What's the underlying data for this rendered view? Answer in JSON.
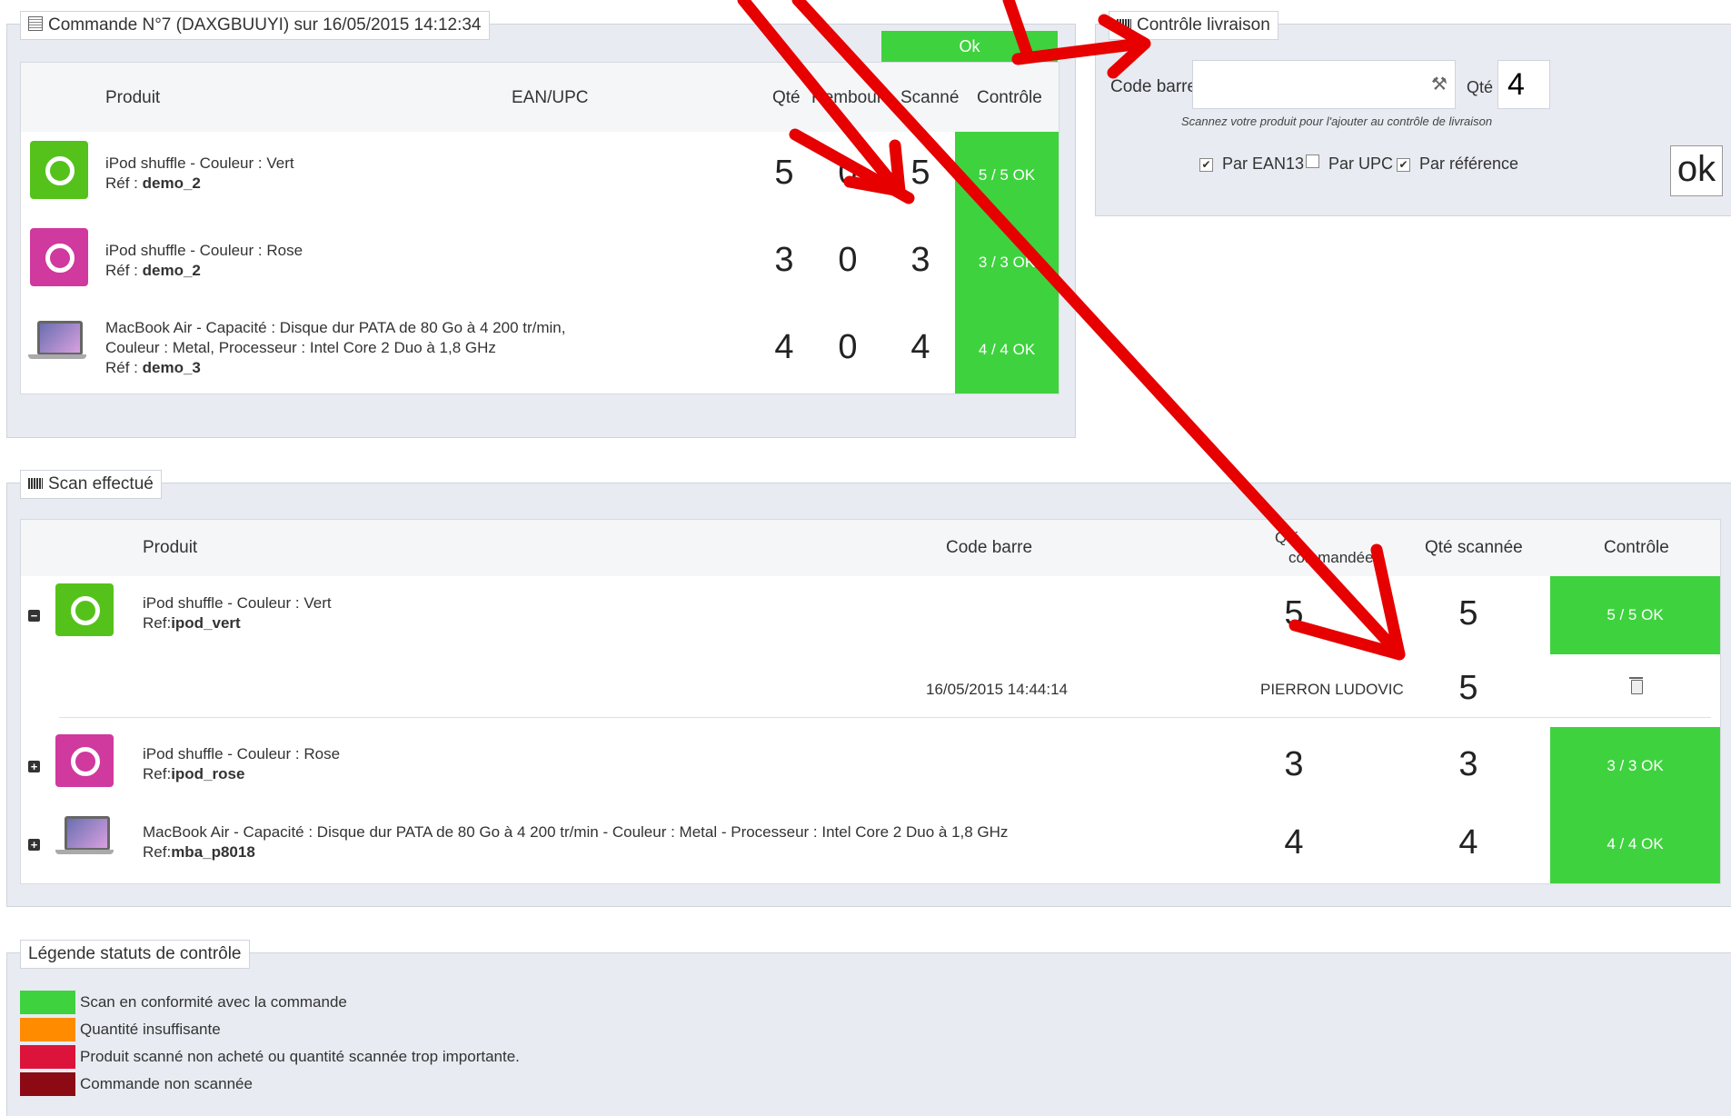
{
  "order_panel": {
    "title": "Commande N°7 (DAXGBUUYI) sur 16/05/2015 14:12:34",
    "ok_banner": "Ok",
    "headers": {
      "product": "Produit",
      "ean": "EAN/UPC",
      "qty": "Qté",
      "refund": "Rembours",
      "scanned": "Scanné",
      "control": "Contrôle"
    },
    "rows": [
      {
        "line1": "iPod shuffle - Couleur : Vert",
        "line2": "",
        "ref_label": "Réf : ",
        "ref": "demo_2",
        "qty": "5",
        "refund": "0",
        "scanned": "5",
        "control": "5 / 5 OK",
        "thumb_color": "#55c21b"
      },
      {
        "line1": "iPod shuffle - Couleur : Rose",
        "line2": "",
        "ref_label": "Réf : ",
        "ref": "demo_2",
        "qty": "3",
        "refund": "0",
        "scanned": "3",
        "control": "3 / 3 OK",
        "thumb_color": "#d0399e"
      },
      {
        "line1": "MacBook Air - Capacité : Disque dur PATA de 80 Go à 4 200 tr/min,",
        "line2": "Couleur : Metal, Processeur : Intel Core 2 Duo à 1,8 GHz",
        "ref_label": "Réf : ",
        "ref": "demo_3",
        "qty": "4",
        "refund": "0",
        "scanned": "4",
        "control": "4 / 4 OK",
        "thumb_color": "#9aa"
      }
    ]
  },
  "delivery_panel": {
    "title": "Contrôle livraison",
    "barcode_label": "Code barre",
    "barcode_value": "",
    "qty_label": "Qté",
    "qty_value": "4",
    "hint": "Scannez votre produit pour l'ajouter au contrôle de livraison",
    "checkboxes": [
      {
        "label": "Par EAN13",
        "checked": true
      },
      {
        "label": "Par UPC",
        "checked": false
      },
      {
        "label": "Par référence",
        "checked": true
      }
    ],
    "ok_button": "ok"
  },
  "scan_panel": {
    "title": "Scan effectué",
    "headers": {
      "product": "Produit",
      "barcode": "Code barre",
      "qty_ordered_1": "Qté",
      "qty_ordered_2": "commandée",
      "qty_scanned": "Qté scannée",
      "control": "Contrôle"
    },
    "rows": [
      {
        "toggle": "−",
        "line1": "iPod shuffle - Couleur : Vert",
        "ref_label": "Ref:",
        "ref": "ipod_vert",
        "qty_ordered": "5",
        "qty_scanned": "5",
        "control": "5 / 5 OK",
        "thumb_color": "#55c21b"
      },
      {
        "toggle": "+",
        "line1": "iPod shuffle - Couleur : Rose",
        "ref_label": "Ref:",
        "ref": "ipod_rose",
        "qty_ordered": "3",
        "qty_scanned": "3",
        "control": "3 / 3 OK",
        "thumb_color": "#d0399e"
      },
      {
        "toggle": "+",
        "line1": "MacBook Air - Capacité : Disque dur PATA de 80 Go à 4 200 tr/min - Couleur : Metal - Processeur : Intel Core 2 Duo à 1,8 GHz",
        "ref_label": "Ref:",
        "ref": "mba_p8018",
        "qty_ordered": "4",
        "qty_scanned": "4",
        "control": "4 / 4 OK",
        "thumb_color": "#9aa"
      }
    ],
    "detail": {
      "date": "16/05/2015 14:44:14",
      "user": "PIERRON LUDOVIC",
      "qty": "5"
    }
  },
  "legend_panel": {
    "title": "Légende statuts de contrôle",
    "items": [
      {
        "color": "#3fd23f",
        "label": "Scan en conformité avec la commande"
      },
      {
        "color": "#ff8c00",
        "label": "Quantité insuffisante"
      },
      {
        "color": "#dc143c",
        "label": "Produit scanné non acheté ou quantité scannée trop importante."
      },
      {
        "color": "#8b0a14",
        "label": "Commande non scannée"
      }
    ]
  }
}
